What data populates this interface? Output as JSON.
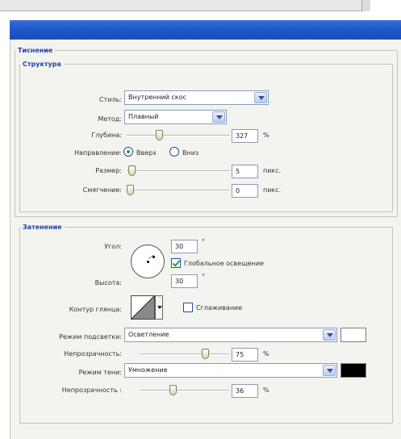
{
  "colors": {
    "title_bar": "#1f57c9",
    "highlight_swatch": "#ffffff",
    "shadow_swatch": "#000000",
    "legend": "#1f3fa8"
  },
  "bevel": {
    "group_title": "Тиснение",
    "structure": {
      "title": "Структура",
      "style": {
        "label": "Стиль:",
        "value": "Внутренний скос"
      },
      "method": {
        "label": "Метод:",
        "value": "Плавный"
      },
      "depth": {
        "label": "Глубина:",
        "value": "327",
        "unit": "%",
        "slider_level": 0.3
      },
      "direction": {
        "label": "Направление:",
        "up": "Вверх",
        "down": "Вниз",
        "selected": "up"
      },
      "size": {
        "label": "Размер:",
        "value": "5",
        "unit": "пикс.",
        "slider_level": 0.02
      },
      "soften": {
        "label": "Смягчение:",
        "value": "0",
        "unit": "пикс.",
        "slider_level": 0.0
      }
    }
  },
  "shading": {
    "title": "Затенение",
    "angle": {
      "label": "Угол:",
      "value": "30",
      "unit": "°"
    },
    "global_light": {
      "label": "Глобальное освещение",
      "checked": true
    },
    "altitude": {
      "label": "Высота:",
      "value": "30",
      "unit": "°"
    },
    "gloss_contour": {
      "label": "Контур глянца:",
      "icon": "gloss-contour-icon"
    },
    "antialias": {
      "label": "Сглаживание",
      "checked": false
    },
    "highlight_mode": {
      "label": "Режим подсветки:",
      "value": "Осветление"
    },
    "highlight_opacity": {
      "label": "Непрозрачность:",
      "value": "75",
      "unit": "%",
      "slider_level": 0.75
    },
    "shadow_mode": {
      "label": "Режим тени:",
      "value": "Умножение"
    },
    "shadow_opacity": {
      "label": "Непрозрачность :",
      "value": "36",
      "unit": "%",
      "slider_level": 0.36
    }
  }
}
